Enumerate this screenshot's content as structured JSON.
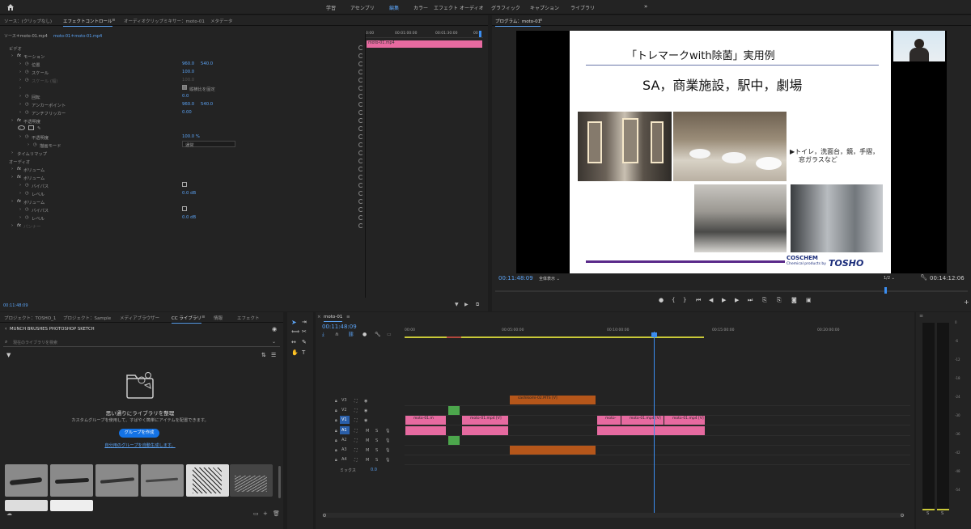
{
  "workspaces": [
    "学習",
    "アセンブリ",
    "編集",
    "カラー",
    "エフェクト",
    "オーディオ",
    "グラフィック",
    "キャプション",
    "ライブラリ"
  ],
  "active_workspace": "編集",
  "source_panel": {
    "tabs": [
      "ソース：(クリップなし)",
      "エフェクトコントロール",
      "オーディオクリップミキサー：moto-01",
      "メタデータ"
    ],
    "sub_source": "ソース＊moto-01.mp4",
    "sub_seq": "moto-01＊moto-01.mp4",
    "timeline_marks": [
      "0:00",
      "00:01:00:00",
      "00:01:30:00",
      "00"
    ],
    "clip_name": "moto-01.mp4",
    "timecode": "00:11:48:09",
    "rows": [
      {
        "label": "ビデオ",
        "indent": 0,
        "v1": "",
        "v2": ""
      },
      {
        "label": "モーション",
        "indent": 1,
        "fx": true,
        "v1": "",
        "v2": ""
      },
      {
        "label": "位置",
        "indent": 2,
        "v1": "960.0",
        "v2": "540.0"
      },
      {
        "label": "スケール",
        "indent": 2,
        "v1": "100.0",
        "v2": ""
      },
      {
        "label": "スケール (幅)",
        "indent": 2,
        "v1": "100.0",
        "v2": "",
        "dim": true
      },
      {
        "label": "",
        "indent": 2,
        "v1": "",
        "v2": "",
        "check": "縦横比を固定"
      },
      {
        "label": "回転",
        "indent": 2,
        "v1": "0.0",
        "v2": ""
      },
      {
        "label": "アンカーポイント",
        "indent": 2,
        "v1": "960.0",
        "v2": "540.0"
      },
      {
        "label": "アンチフリッカー",
        "indent": 2,
        "v1": "0.00",
        "v2": ""
      },
      {
        "label": "不透明度",
        "indent": 1,
        "fx": true,
        "v1": "",
        "v2": ""
      },
      {
        "label": "",
        "indent": 2,
        "v1": "",
        "v2": "",
        "shapes": true
      },
      {
        "label": "不透明度",
        "indent": 2,
        "v1": "100.0 %",
        "v2": ""
      },
      {
        "label": "描画モード",
        "indent": 3,
        "v1": "",
        "v2": "",
        "select": "通常"
      },
      {
        "label": "タイムリマップ",
        "indent": 1,
        "v1": "",
        "v2": ""
      },
      {
        "label": "オーディオ",
        "indent": 0,
        "v1": "",
        "v2": ""
      },
      {
        "label": "ボリューム",
        "indent": 1,
        "fx": true,
        "v1": "",
        "v2": ""
      },
      {
        "label": "ボリューム",
        "indent": 1,
        "fx": true,
        "v1": "",
        "v2": ""
      },
      {
        "label": "バイパス",
        "indent": 2,
        "v1": "",
        "v2": "",
        "box": true
      },
      {
        "label": "レベル",
        "indent": 2,
        "v1": "0.0 dB",
        "v2": ""
      },
      {
        "label": "ボリューム",
        "indent": 1,
        "fx": true,
        "v1": "",
        "v2": ""
      },
      {
        "label": "バイパス",
        "indent": 2,
        "v1": "",
        "v2": "",
        "box": true
      },
      {
        "label": "レベル",
        "indent": 2,
        "v1": "0.0 dB",
        "v2": ""
      },
      {
        "label": "パンナー",
        "indent": 1,
        "fx": true,
        "v1": "",
        "v2": "",
        "dim": true
      }
    ]
  },
  "program": {
    "title": "プログラム：moto-01",
    "timecode": "00:11:48:09",
    "fit": "全体表示",
    "quality": "1/2",
    "duration": "00:14:12:06",
    "slide": {
      "title": "「トレマークwith除菌」実用例",
      "subtitle": "SA，商業施設，駅中，劇場",
      "bullet": "▶トイレ，洗面台，鏡，手摺，",
      "bullet2": "窓ガラスなど",
      "logo": "COSCHEM",
      "logo_sub": "Chemical products by",
      "logo_brand": "TOSHO"
    }
  },
  "project": {
    "tabs": [
      "プロジェクト：TOSHO_1",
      "プロジェクト：Sample",
      "メディアブラウザー",
      "CC ライブラリ",
      "情報",
      "エフェクト"
    ],
    "library_name": "MUNCH BRUSHES PHOTOSHOP SKETCH",
    "search_placeholder": "現在のライブラリを検索",
    "empty_title": "思い通りにライブラリを整理",
    "empty_desc": "カスタムグループを使用して、すばやく簡単にアイテムを配置できます。",
    "create_btn": "グループを作成",
    "auto_link": "自分用のグループを自動生成します。"
  },
  "timeline": {
    "tab": "moto-01",
    "timecode": "00:11:48:09",
    "ruler": [
      "00:00",
      "00:05:00:00",
      "00:10:00:00",
      "00:15:00:00",
      "00:20:00:00"
    ],
    "tracks": [
      "V3",
      "V2",
      "V1",
      "A1",
      "A2",
      "A3",
      "A4"
    ],
    "mix_label": "ミックス",
    "mix_value": "0.0",
    "clip_v3": "sashikomi-02.MTS [V]",
    "clips_v1": [
      "moto-01.m",
      "moto-01.mp4 [V]",
      "moto-",
      "moto-01.mp4 [V]",
      "moto-01.mp4 [V]"
    ]
  },
  "meter": {
    "scale": [
      "0",
      "-6",
      "-12",
      "-18",
      "-24",
      "-30",
      "-36",
      "-42",
      "-48",
      "-54"
    ],
    "solo": [
      "S",
      "S"
    ]
  }
}
